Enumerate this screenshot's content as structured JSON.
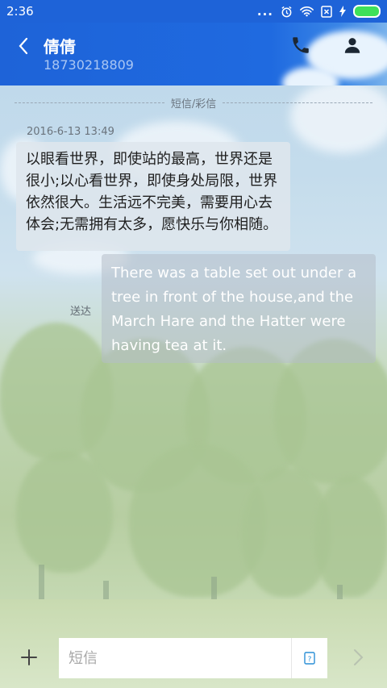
{
  "status_bar": {
    "time": "2:36",
    "overflow_dots": "..."
  },
  "header": {
    "contact_name": "倩倩",
    "contact_number": "18730218809"
  },
  "conversation": {
    "divider_label": "短信/彩信",
    "timestamp": "2016-6-13 13:49",
    "incoming_message": "以眼看世界，即使站的最高，世界还是很小;以心看世界，即使身处局限，世界依然很大。生活远不完美，需要用心去体会;无需拥有太多，愿快乐与你相随。",
    "outgoing_message": "There was a table set out under a tree in front of the house,and the March Hare and the Hatter were having tea at it.",
    "delivery_status": "送达"
  },
  "input": {
    "placeholder": "短信",
    "template_icon_glyph": "?"
  },
  "colors": {
    "header_blue": "#1e63d8",
    "battery_green": "#3ee05a"
  },
  "icons": [
    "back-arrow-icon",
    "phone-icon",
    "person-icon",
    "plus-icon",
    "template-icon",
    "send-arrow-icon",
    "alarm-icon",
    "wifi-icon",
    "sim-x-icon",
    "charging-bolt-icon"
  ]
}
